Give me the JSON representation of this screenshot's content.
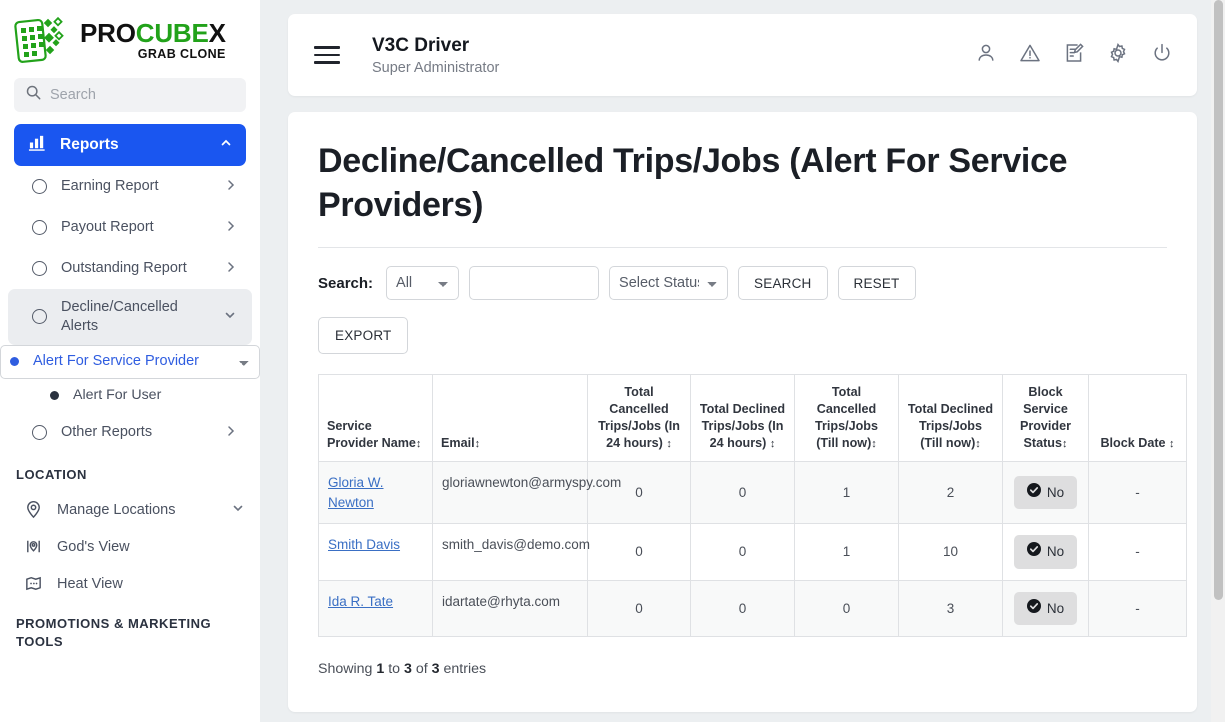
{
  "brand": {
    "logo_icon": "grid-phone-logo-icon",
    "name_pro": "PRO",
    "name_cube": "CUBE",
    "name_x": "X",
    "tagline": "GRAB CLONE",
    "accent_green": "#22a21a",
    "accent_blue": "#1a56f0"
  },
  "sidebar": {
    "search_placeholder": "Search",
    "primary": {
      "label": "Reports",
      "icon": "bar-chart-icon",
      "chevron": "chevron-up-icon"
    },
    "items": [
      {
        "label": "Earning Report",
        "chevron": "chevron-right-icon"
      },
      {
        "label": "Payout Report",
        "chevron": "chevron-right-icon"
      },
      {
        "label": "Outstanding Report",
        "chevron": "chevron-right-icon"
      },
      {
        "label": "Decline/Cancelled Alerts",
        "chevron": "chevron-down-icon"
      }
    ],
    "sub_items": [
      {
        "label": "Alert For Service Provider",
        "selected": true
      },
      {
        "label": "Alert For User",
        "selected": false
      }
    ],
    "other_reports": {
      "label": "Other Reports",
      "chevron": "chevron-right-icon"
    },
    "location_section": "LOCATION",
    "location_items": [
      {
        "label": "Manage Locations",
        "icon": "map-pin-icon",
        "chevron": "chevron-down-icon"
      },
      {
        "label": "God's View",
        "icon": "map-locate-icon",
        "chevron": ""
      },
      {
        "label": "Heat View",
        "icon": "heat-map-icon",
        "chevron": ""
      }
    ],
    "promotions_section": "PROMOTIONS & MARKETING TOOLS"
  },
  "topbar": {
    "menu_icon": "hamburger-menu-icon",
    "title": "V3C Driver",
    "subtitle": "Super Administrator",
    "icons": [
      {
        "name": "user-profile-icon"
      },
      {
        "name": "warning-triangle-icon"
      },
      {
        "name": "edit-document-icon"
      },
      {
        "name": "gear-settings-icon"
      },
      {
        "name": "power-logout-icon"
      }
    ]
  },
  "page": {
    "title": "Decline/Cancelled Trips/Jobs (Alert For Service Providers)",
    "filters": {
      "search_label": "Search:",
      "type_selected": "All",
      "text_value": "",
      "text_placeholder": "",
      "status_selected": "Select Status",
      "search_button": "SEARCH",
      "reset_button": "RESET",
      "export_button": "EXPORT"
    },
    "table": {
      "headers": [
        "Service Provider Name",
        "Email",
        "Total Cancelled Trips/Jobs (In 24 hours)",
        "Total Declined Trips/Jobs (In 24 hours)",
        "Total Cancelled Trips/Jobs (Till now)",
        "Total Declined Trips/Jobs (Till now)",
        "Block Service Provider Status",
        "Block Date"
      ],
      "sort_icon": "sort-updown-icon",
      "rows": [
        {
          "name": "Gloria W. Newton",
          "email": "gloriawnewton@armyspy.com",
          "cancelled_24h": "0",
          "declined_24h": "0",
          "cancelled_total": "1",
          "declined_total": "2",
          "block_status": "No",
          "block_status_icon": "check-circle-icon",
          "block_date": "-"
        },
        {
          "name": "Smith Davis",
          "email": "smith_davis@demo.com",
          "cancelled_24h": "0",
          "declined_24h": "0",
          "cancelled_total": "1",
          "declined_total": "10",
          "block_status": "No",
          "block_status_icon": "check-circle-icon",
          "block_date": "-"
        },
        {
          "name": "Ida R. Tate",
          "email": "idartate@rhyta.com",
          "cancelled_24h": "0",
          "declined_24h": "0",
          "cancelled_total": "0",
          "declined_total": "3",
          "block_status": "No",
          "block_status_icon": "check-circle-icon",
          "block_date": "-"
        }
      ]
    },
    "showing": {
      "prefix": "Showing",
      "from": "1",
      "mid": "to",
      "to": "3",
      "mid2": "of",
      "total": "3",
      "suffix": "entries"
    }
  }
}
